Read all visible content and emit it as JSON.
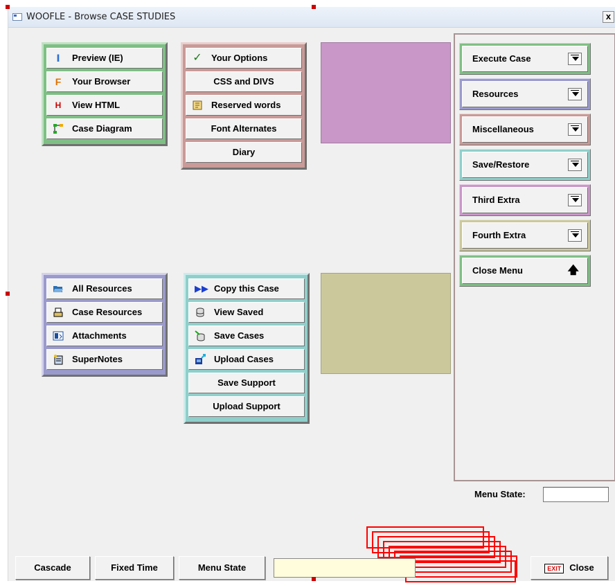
{
  "window": {
    "title": "WOOFLE - Browse CASE STUDIES",
    "close_glyph": "x"
  },
  "group_view": {
    "items": [
      {
        "label": "Preview (IE)",
        "icon": "ie-preview-icon"
      },
      {
        "label": "Your Browser",
        "icon": "firefox-browser-icon"
      },
      {
        "label": "View HTML",
        "icon": "html-icon"
      },
      {
        "label": "Case Diagram",
        "icon": "diagram-icon"
      }
    ]
  },
  "group_options": {
    "items": [
      {
        "label": "Your Options",
        "icon": "checkmark-icon"
      },
      {
        "label": "CSS and DIVS",
        "icon": ""
      },
      {
        "label": "Reserved words",
        "icon": "book-icon"
      },
      {
        "label": "Font Alternates",
        "icon": ""
      },
      {
        "label": "Diary",
        "icon": ""
      }
    ]
  },
  "group_resources": {
    "items": [
      {
        "label": "All Resources",
        "icon": "open-folder-icon"
      },
      {
        "label": "Case Resources",
        "icon": "scanner-icon"
      },
      {
        "label": "Attachments",
        "icon": "attachment-icon"
      },
      {
        "label": "SuperNotes",
        "icon": "notes-icon"
      }
    ]
  },
  "group_cases": {
    "items": [
      {
        "label": "Copy this Case",
        "icon": "fast-forward-icon"
      },
      {
        "label": "View Saved",
        "icon": "database-icon"
      },
      {
        "label": "Save Cases",
        "icon": "save-database-icon"
      },
      {
        "label": "Upload Cases",
        "icon": "upload-icon"
      },
      {
        "label": "Save Support",
        "icon": ""
      },
      {
        "label": "Upload Support",
        "icon": ""
      }
    ]
  },
  "swatches": {
    "top_color": "#c997c8",
    "bottom_color": "#cbc89c"
  },
  "menu": {
    "items": [
      {
        "label": "Execute Case",
        "color": "#7fbf85",
        "light": "#bfe2c2",
        "icon": "dropdown-arrow-icon"
      },
      {
        "label": "Resources",
        "color": "#9a9acc",
        "light": "#d2d2ec",
        "icon": "dropdown-arrow-icon"
      },
      {
        "label": "Miscellaneous",
        "color": "#c99a97",
        "light": "#e8cfcd",
        "icon": "dropdown-arrow-icon"
      },
      {
        "label": "Save/Restore",
        "color": "#8fcfcb",
        "light": "#c9eceb",
        "icon": "dropdown-arrow-icon"
      },
      {
        "label": "Third Extra",
        "color": "#c997c8",
        "light": "#e6cce5",
        "icon": "dropdown-arrow-icon"
      },
      {
        "label": "Fourth Extra",
        "color": "#cbc89c",
        "light": "#e8e6cc",
        "icon": "dropdown-arrow-icon"
      },
      {
        "label": "Close Menu",
        "color": "#7fbf85",
        "light": "#bfe2c2",
        "icon": "up-arrow-icon"
      }
    ]
  },
  "menu_state": {
    "label": "Menu State:",
    "value": ""
  },
  "bottom_bar": {
    "cascade": "Cascade",
    "fixed_time": "Fixed Time",
    "menu_state": "Menu State",
    "status_text": "",
    "exit_badge": "EXIT",
    "close": "Close"
  }
}
